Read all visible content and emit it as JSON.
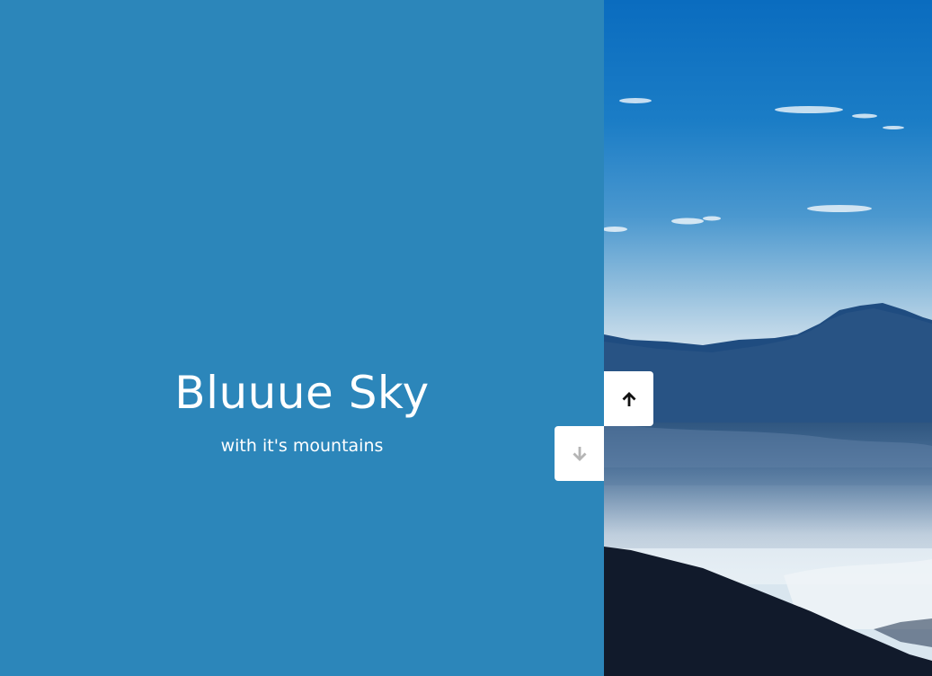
{
  "slide": {
    "title": "Bluuue Sky",
    "subtitle": "with it's mountains",
    "panel_color": "#2c86ba"
  },
  "image": {
    "subject": "mountains-under-blue-sky-photo"
  },
  "controls": {
    "up_icon": "arrow-up-icon",
    "down_icon": "arrow-down-icon",
    "up_color": "#111111",
    "down_color": "#b5b5b5"
  }
}
